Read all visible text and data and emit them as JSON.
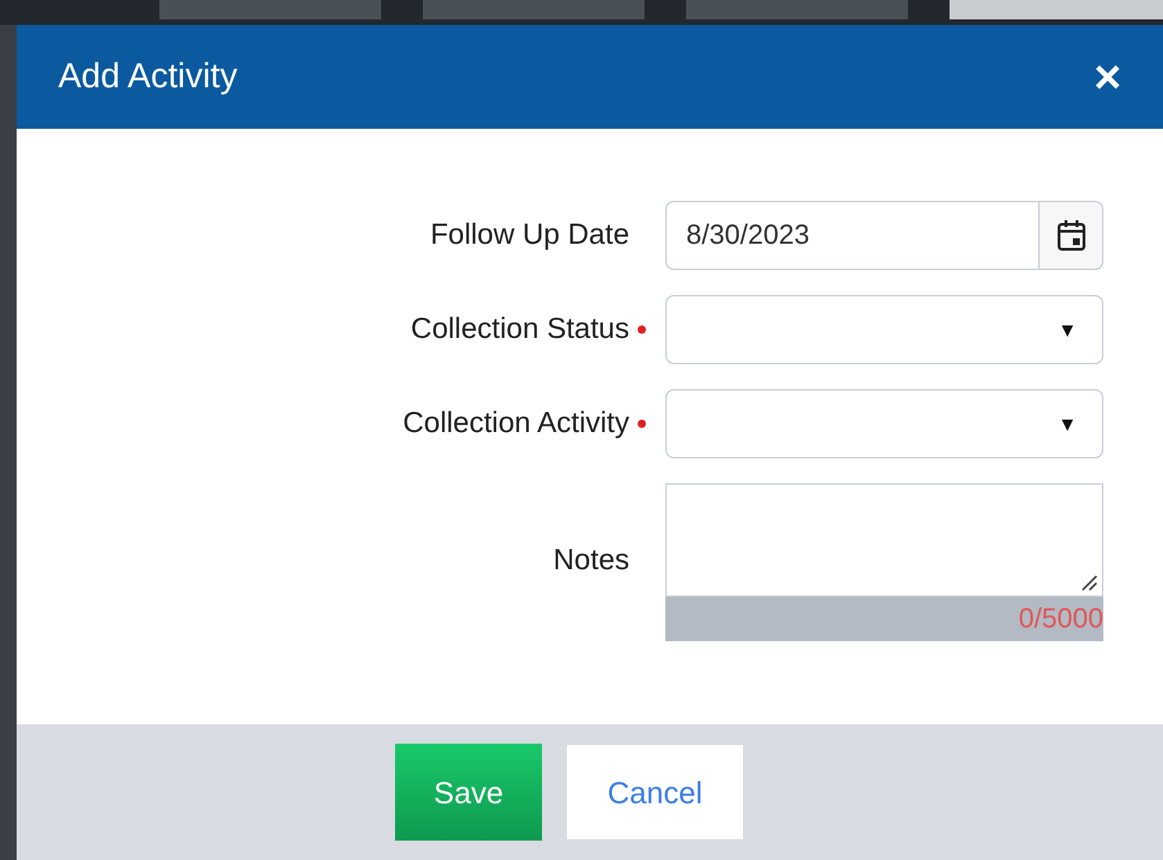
{
  "tabs": [
    {
      "selected": false
    },
    {
      "selected": false
    },
    {
      "selected": false
    },
    {
      "selected": true
    }
  ],
  "dialog": {
    "title": "Add Activity",
    "close": "×"
  },
  "fields": [
    {
      "kind": "date",
      "label": "Follow Up Date",
      "required": false,
      "value": "8/30/2023"
    },
    {
      "kind": "select",
      "label": "Collection Status",
      "required": true,
      "arrow": "▼"
    },
    {
      "kind": "select",
      "label": "Collection Activity",
      "required": true,
      "arrow": "▼"
    },
    {
      "kind": "textarea",
      "label": "Notes",
      "required": false,
      "counter": "0/5000"
    }
  ],
  "buttons": [
    {
      "label": "Save",
      "kind": "primary"
    },
    {
      "label": "Cancel",
      "kind": "secondary"
    }
  ]
}
